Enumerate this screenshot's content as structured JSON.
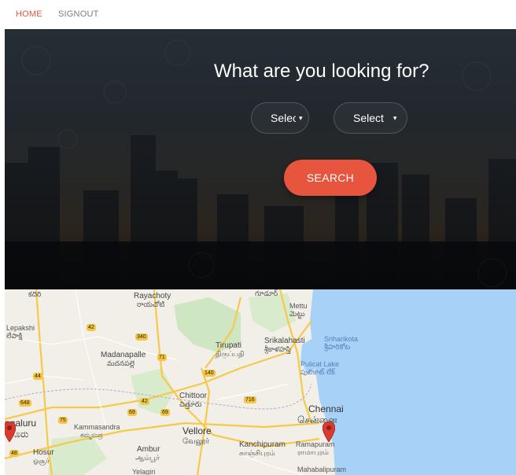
{
  "nav": {
    "home": "HOME",
    "signout": "SIGNOUT"
  },
  "hero": {
    "title": "What are you looking for?",
    "select_1": "Select",
    "select_2": "Select",
    "caret": "▾",
    "search_label": "SEARCH"
  },
  "map": {
    "labels": {
      "rayachoty": "Rayachoty",
      "rayachoty_te": "రాయచోటి",
      "gudur": "గూడూర్",
      "mettu": "Mettu",
      "mettu_te": "మెట్టు",
      "kadiri": "కదిరి",
      "lepakshi": "Lepakshi",
      "lepakshi_te": "లేపాక్షి",
      "madanapalle": "Madanapalle",
      "madanapalle_te": "మదనపల్లె",
      "tirupati": "Tirupati",
      "tirupati_ta": "திருப்பதி",
      "srikalahasti": "Srikalahasti",
      "srikalahasti_te": "శ్రీకాళహస్తి",
      "sriharikota": "Sriharikota",
      "sriharikota_te": "శ్రీహరికోట",
      "pulicat": "Pulicat Lake",
      "pulicat_te": "పులికాట్ లేక్",
      "chittoor": "Chittoor",
      "chittoor_te": "చిత్తూరు",
      "chennai": "Chennai",
      "chennai_ta": "சென்னை",
      "bengaluru": "ngaluru",
      "bengaluru_kn": "ಳೂರು",
      "kammasandra": "Kammasandra",
      "kammasandra_kn": "ಕಮ್ಮಸಂದ್ರ",
      "vellore": "Vellore",
      "vellore_ta": "வேலூர்",
      "hosur": "Hosur",
      "hosur_ta": "ஓசூர்",
      "ambur": "Ambur",
      "ambur_ta": "ஆம்பூர்",
      "kanchipuram": "Kanchipuram",
      "kanchipuram_ta": "காஞ்சிபுரம்",
      "ramapuram": "Ramapuram",
      "ramapuram_ta": "ராமாபுரம்",
      "mahabalipuram": "Mahabalipuram",
      "yelagiri": "Yelagiri"
    },
    "shields": {
      "r42": "42",
      "r340": "340",
      "r71": "71",
      "r140": "140",
      "r44": "44",
      "r648": "648",
      "r42b": "42",
      "r716": "716",
      "r69a": "69",
      "r69b": "69",
      "r75": "75",
      "r48": "48"
    },
    "colors": {
      "land": "#f1efe8",
      "water": "#a7d1f7",
      "forest": "#cfe6c2",
      "road": "#f7c948",
      "pin": "#d93a2f"
    }
  }
}
